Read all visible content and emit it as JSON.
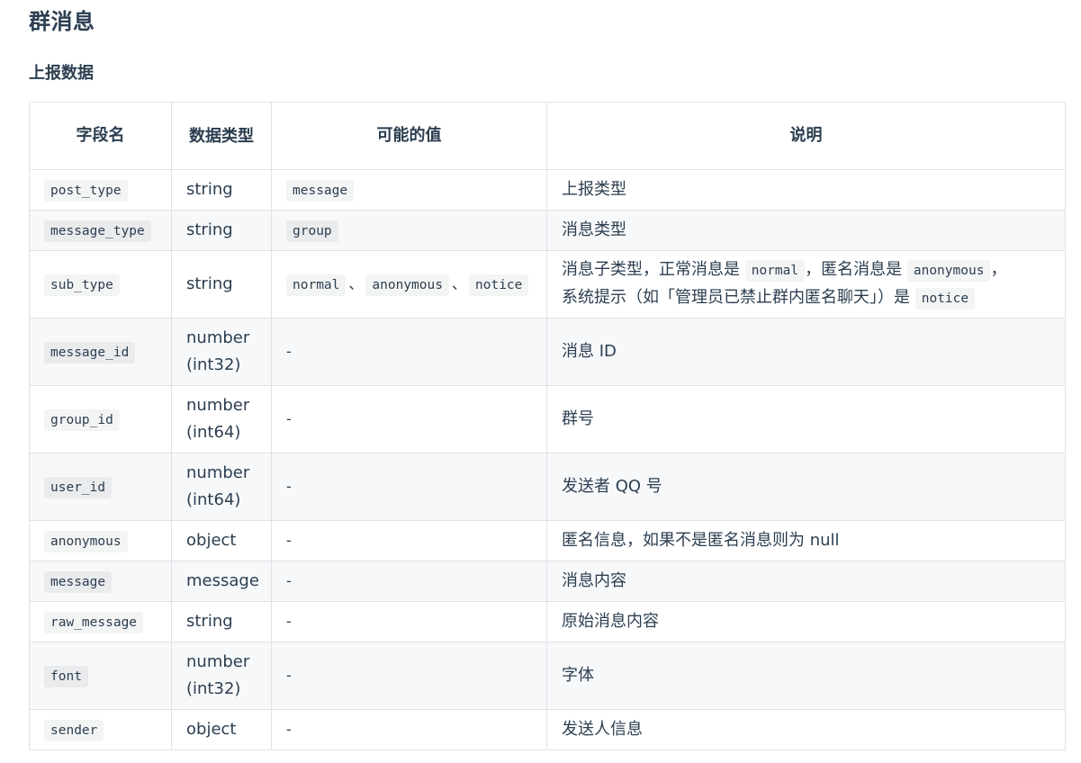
{
  "page": {
    "title": "群消息",
    "subtitle": "上报数据"
  },
  "table": {
    "headers": {
      "field": "字段名",
      "type": "数据类型",
      "values": "可能的值",
      "desc": "说明"
    },
    "rows": [
      {
        "field": "post_type",
        "type": "string",
        "values": "message",
        "desc": "上报类型"
      },
      {
        "field": "message_type",
        "type": "string",
        "values": "group",
        "desc": "消息类型"
      },
      {
        "field": "sub_type",
        "type": "string",
        "values_list": [
          "normal",
          "anonymous",
          "notice"
        ],
        "value_separator": "、",
        "desc_parts": {
          "p1": "消息子类型，正常消息是",
          "c1": "normal",
          "p2": "，匿名消息是",
          "c2": "anonymous",
          "p3": "，",
          "p4": "系统提示（如「管理员已禁止群内匿名聊天」）是",
          "c3": "notice"
        }
      },
      {
        "field": "message_id",
        "type_line1": "number",
        "type_line2": "(int32)",
        "values": "-",
        "desc": "消息 ID"
      },
      {
        "field": "group_id",
        "type_line1": "number",
        "type_line2": "(int64)",
        "values": "-",
        "desc": "群号"
      },
      {
        "field": "user_id",
        "type_line1": "number",
        "type_line2": "(int64)",
        "values": "-",
        "desc": "发送者 QQ 号"
      },
      {
        "field": "anonymous",
        "type": "object",
        "values": "-",
        "desc": "匿名信息，如果不是匿名消息则为 null"
      },
      {
        "field": "message",
        "type": "message",
        "values": "-",
        "desc": "消息内容"
      },
      {
        "field": "raw_message",
        "type": "string",
        "values": "-",
        "desc": "原始消息内容"
      },
      {
        "field": "font",
        "type_line1": "number",
        "type_line2": "(int32)",
        "values": "-",
        "desc": "字体"
      },
      {
        "field": "sender",
        "type": "object",
        "values": "-",
        "desc": "发送人信息"
      }
    ]
  }
}
